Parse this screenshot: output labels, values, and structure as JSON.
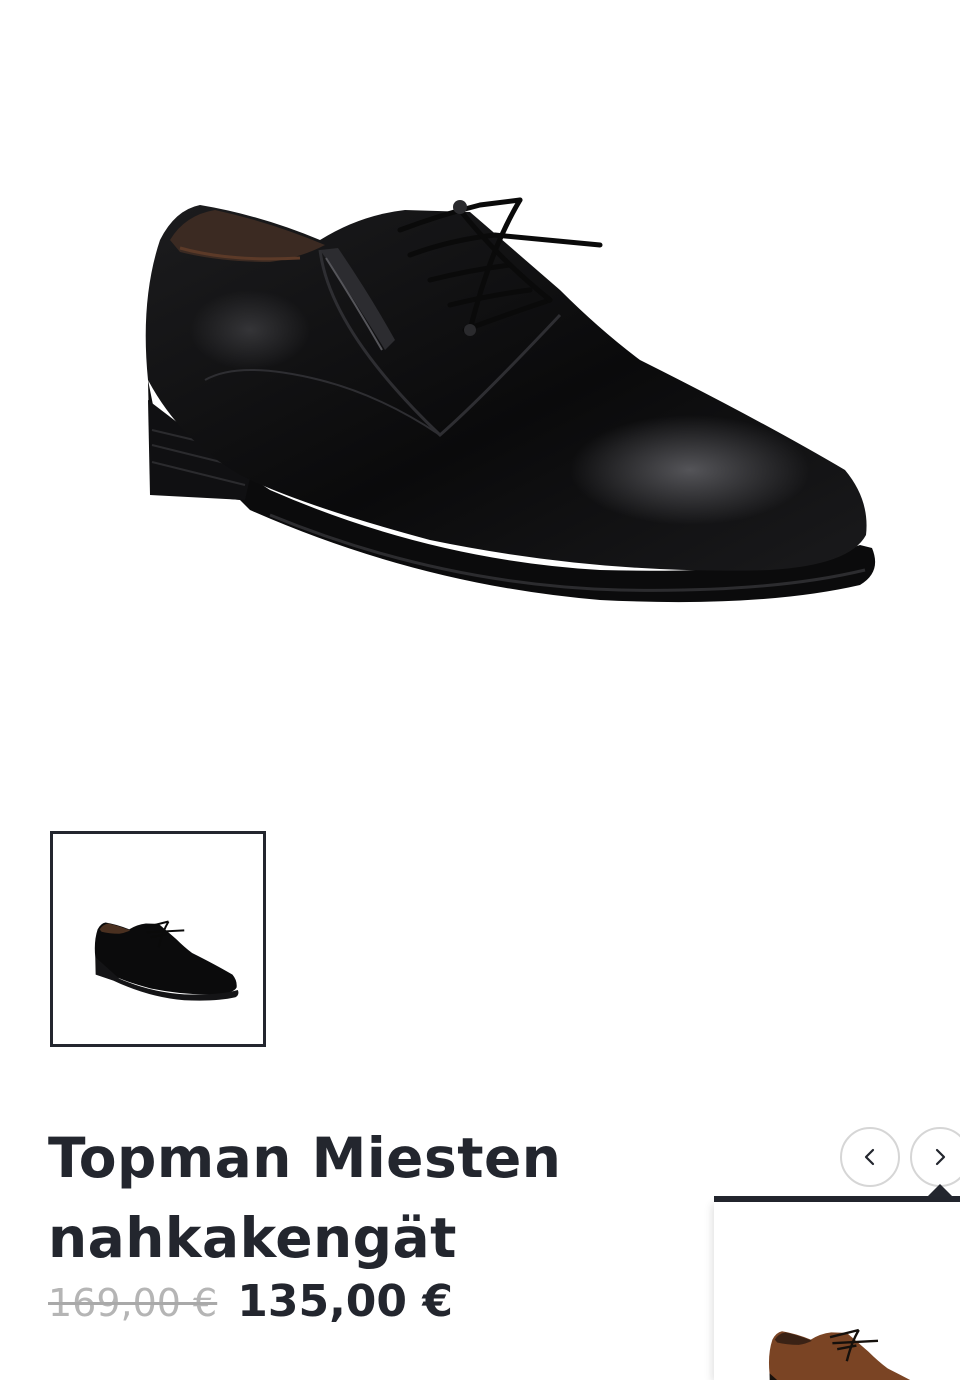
{
  "product": {
    "title_line1": "Topman Miesten",
    "title_line2": "nahkakengät",
    "old_price": "169,00 €",
    "new_price": "135,00 €",
    "main_image_icon": "black-leather-derby-shoe",
    "thumbnail_icon": "black-leather-derby-shoe",
    "color": "#0b0b0c"
  },
  "related": {
    "prev_icon": "chevron-left-icon",
    "next_icon": "chevron-right-icon",
    "card_image_icon": "brown-leather-derby-shoe",
    "card_color": "#7a4424"
  },
  "colors": {
    "text": "#23262e",
    "old_price": "#b5b5b5",
    "border": "#23262e"
  }
}
